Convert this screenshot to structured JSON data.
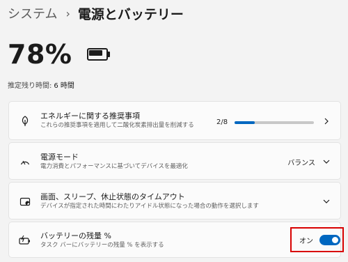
{
  "breadcrumb": {
    "parent": "システム",
    "separator": "›",
    "current": "電源とバッテリー"
  },
  "battery": {
    "percent_text": "78%",
    "level": 0.78,
    "remaining_label": "推定残り時間:",
    "remaining_value": "6 時間"
  },
  "cards": {
    "energy": {
      "icon": "leaf-icon",
      "title": "エネルギーに関する推奨事項",
      "subtitle": "これらの推奨事項を適用して二酸化炭素排出量を削減する",
      "progress_label": "2/8",
      "progress_value": 0.25
    },
    "power_mode": {
      "icon": "power-mode-gauge-icon",
      "title": "電源モード",
      "subtitle": "電力消費とパフォーマンスに基づいてデバイスを最適化",
      "value": "バランス"
    },
    "screen_sleep": {
      "icon": "screen-sleep-icon",
      "title": "画面、スリープ、休止状態のタイムアウト",
      "subtitle": "デバイスが指定された時間にわたりアイドル状態になった場合の動作を選択します"
    },
    "battery_percent": {
      "icon": "battery-charging-icon",
      "title": "バッテリーの残量 %",
      "subtitle": "タスク バーにバッテリーの残量 % を表示する",
      "toggle_label": "オン",
      "toggle_on": true
    }
  },
  "colors": {
    "accent": "#0067c0",
    "highlight_border": "#d80000",
    "background": "#f3f3f3",
    "card": "#fbfbfb"
  }
}
